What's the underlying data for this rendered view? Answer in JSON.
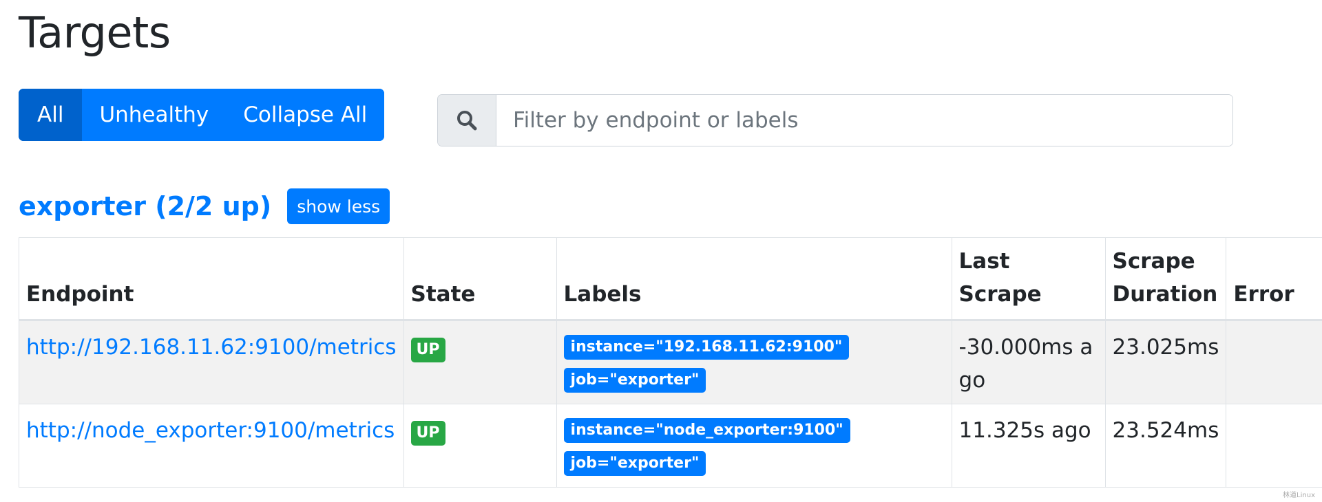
{
  "page": {
    "title": "Targets"
  },
  "filters": {
    "buttons": [
      {
        "label": "All",
        "active": true
      },
      {
        "label": "Unhealthy",
        "active": false
      },
      {
        "label": "Collapse All",
        "active": false
      }
    ]
  },
  "search": {
    "icon": "search-icon",
    "placeholder": "Filter by endpoint or labels",
    "value": ""
  },
  "job": {
    "title": "exporter (2/2 up)",
    "toggle_label": "show less"
  },
  "table": {
    "headers": {
      "endpoint": "Endpoint",
      "state": "State",
      "labels": "Labels",
      "last_scrape": "Last Scrape",
      "scrape_duration_line1": "Scrape",
      "scrape_duration_line2": "Duration",
      "error": "Error"
    },
    "rows": [
      {
        "endpoint": "http://192.168.11.62:9100/metrics",
        "state": "UP",
        "labels": [
          "instance=\"192.168.11.62:9100\"",
          "job=\"exporter\""
        ],
        "last_scrape": "-30.000ms ago",
        "scrape_duration": "23.025ms",
        "error": ""
      },
      {
        "endpoint": "http://node_exporter:9100/metrics",
        "state": "UP",
        "labels": [
          "instance=\"node_exporter:9100\"",
          "job=\"exporter\""
        ],
        "last_scrape": "11.325s ago",
        "scrape_duration": "23.524ms",
        "error": ""
      }
    ]
  },
  "colors": {
    "primary": "#007bff",
    "primary_active": "#0062cc",
    "success": "#28a745",
    "row_stripe": "#f2f2f2"
  },
  "watermark": "林道Linux"
}
